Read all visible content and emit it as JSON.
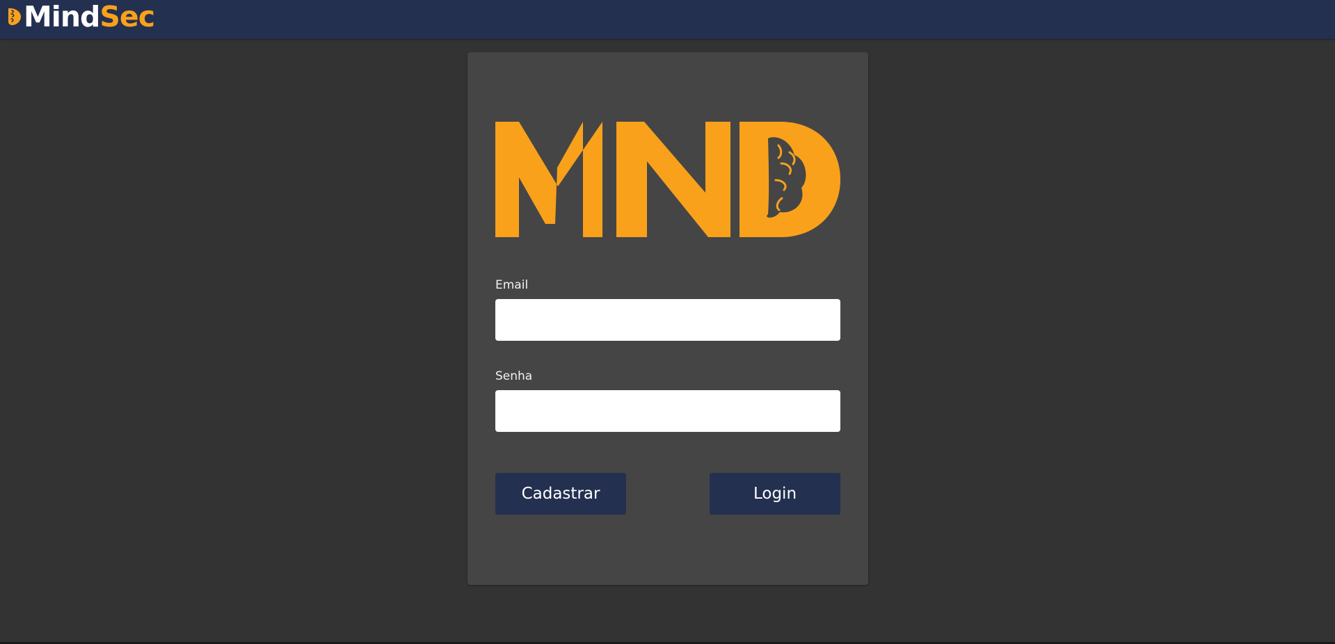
{
  "header": {
    "brand_part1": "Mind",
    "brand_part2": "Sec",
    "brand_icon": "brain-icon"
  },
  "login": {
    "logo_alt": "MND",
    "email_label": "Email",
    "email_value": "",
    "password_label": "Senha",
    "password_value": "",
    "register_label": "Cadastrar",
    "login_label": "Login"
  },
  "colors": {
    "topbar": "#243050",
    "accent": "#f9a11b",
    "background": "#333333",
    "card": "#454545",
    "button": "#243050"
  }
}
